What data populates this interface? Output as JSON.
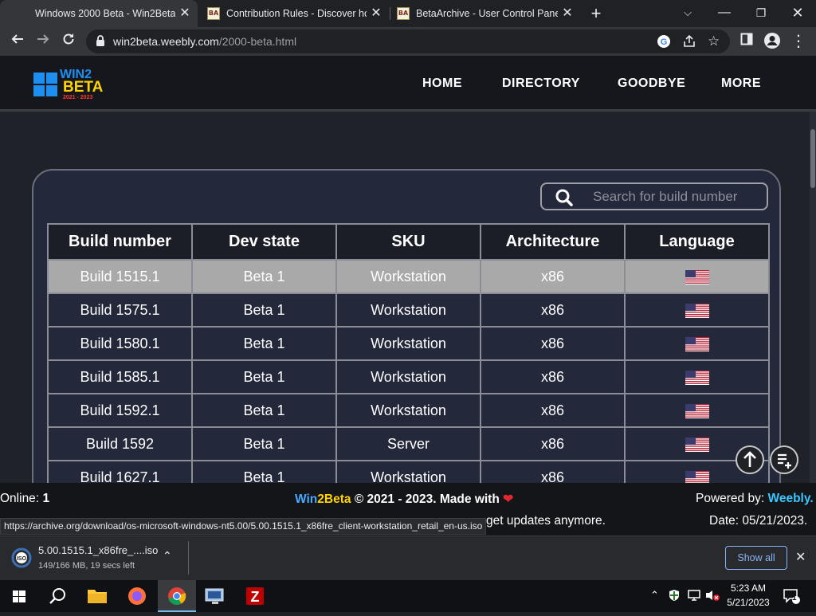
{
  "browser": {
    "tabs": [
      {
        "title": "Windows 2000 Beta - Win2Beta",
        "active": true
      },
      {
        "title": "Contribution Rules - Discover ho",
        "active": false
      },
      {
        "title": "BetaArchive - User Control Panel",
        "active": false
      }
    ],
    "address": {
      "host": "win2beta.weebly.com",
      "path": "/2000-beta.html"
    },
    "status_url": "https://archive.org/download/os-microsoft-windows-nt5.00/5.00.1515.1_x86fre_client-workstation_retail_en-us.iso"
  },
  "site": {
    "logo": {
      "line1": "WIN2",
      "line2": "BETA",
      "years": "2021 - 2023"
    },
    "nav": [
      "HOME",
      "DIRECTORY",
      "GOODBYE",
      "MORE"
    ],
    "search_placeholder": "Search for build number",
    "table": {
      "headers": [
        "Build number",
        "Dev state",
        "SKU",
        "Architecture",
        "Language"
      ],
      "rows": [
        {
          "build": "Build 1515.1",
          "state": "Beta 1",
          "sku": "Workstation",
          "arch": "x86",
          "lang": "us-flag"
        },
        {
          "build": "Build 1575.1",
          "state": "Beta 1",
          "sku": "Workstation",
          "arch": "x86",
          "lang": "us-flag"
        },
        {
          "build": "Build 1580.1",
          "state": "Beta 1",
          "sku": "Workstation",
          "arch": "x86",
          "lang": "us-flag"
        },
        {
          "build": "Build 1585.1",
          "state": "Beta 1",
          "sku": "Workstation",
          "arch": "x86",
          "lang": "us-flag"
        },
        {
          "build": "Build 1592.1",
          "state": "Beta 1",
          "sku": "Workstation",
          "arch": "x86",
          "lang": "us-flag"
        },
        {
          "build": "Build 1592",
          "state": "Beta 1",
          "sku": "Server",
          "arch": "x86",
          "lang": "us-flag"
        },
        {
          "build": "Build 1627.1",
          "state": "Beta 1",
          "sku": "Workstation",
          "arch": "x86",
          "lang": "us-flag"
        }
      ]
    },
    "footer": {
      "online_label": "Online:",
      "online_count": "1",
      "brand_a": "Win",
      "brand_b": "2Beta",
      "copyright": "© 2021 - 2023. Made with",
      "powered_label": "Powered by:",
      "powered_brand": "Weebly.",
      "partial_tail": "get updates anymore.",
      "date": "Date: 05/21/2023."
    }
  },
  "download": {
    "filename": "5.00.1515.1_x86fre_....iso",
    "progress": "149/166 MB, 19 secs left",
    "show_all": "Show all"
  },
  "taskbar": {
    "time": "5:23 AM",
    "date": "5/21/2023",
    "notification_count": "1"
  },
  "colors": {
    "accent_blue": "#4aa8ff",
    "accent_yellow": "#ffd400",
    "heart": "#e0282e",
    "weebly": "#39c8ff"
  }
}
